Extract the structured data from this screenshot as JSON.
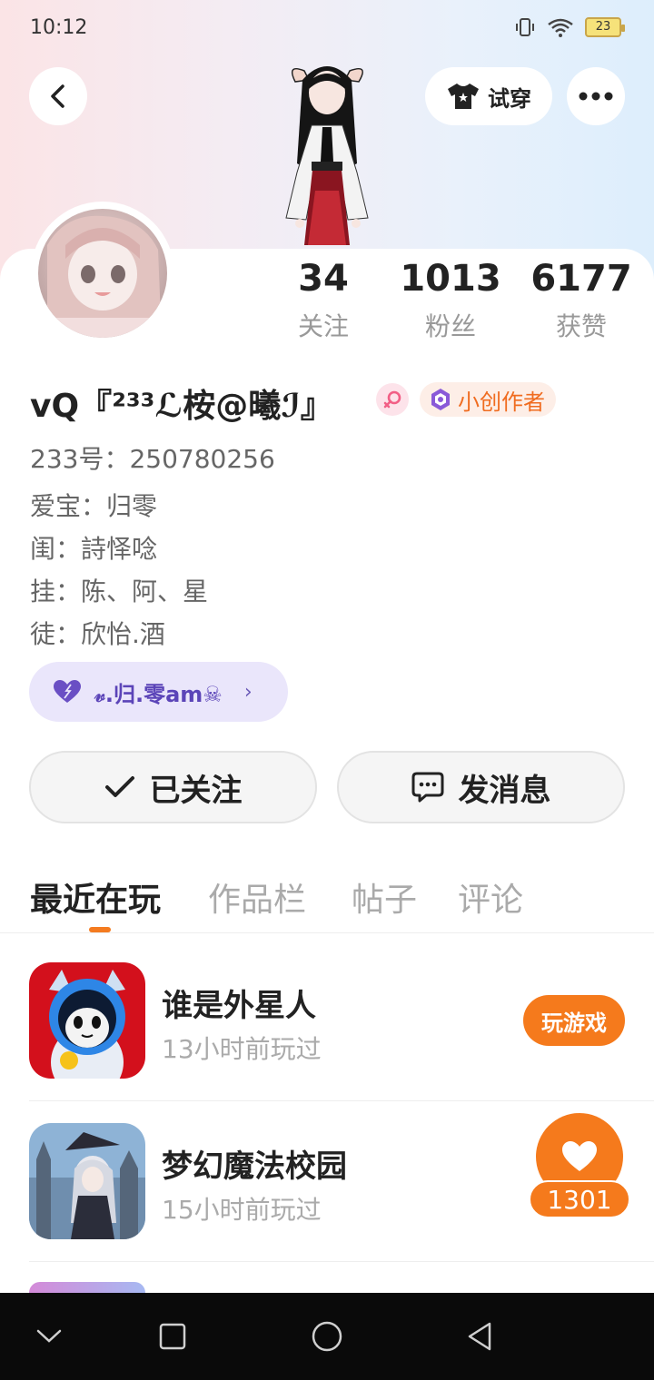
{
  "status_bar": {
    "time": "10:12",
    "battery": "23"
  },
  "header": {
    "try_on_label": "试穿"
  },
  "stats": [
    {
      "value": "34",
      "label": "关注"
    },
    {
      "value": "1013",
      "label": "粉丝"
    },
    {
      "value": "6177",
      "label": "获赞"
    }
  ],
  "profile": {
    "username": "vQ『²³³ℒ桉@曦ℐ』",
    "creator_badge": "小创作者",
    "uid": "233号：250780256",
    "bio_lines": [
      "爱宝：归零",
      "闺：詩怿唸",
      "挂：陈、阿、星",
      "徒：欣怡.酒"
    ],
    "tag": "𝓋.归.零am☠"
  },
  "actions": {
    "follow_label": "已关注",
    "message_label": "发消息"
  },
  "tabs": [
    "最近在玩",
    "作品栏",
    "帖子",
    "评论"
  ],
  "games": [
    {
      "title": "谁是外星人",
      "time": "13小时前玩过",
      "button": "玩游戏"
    },
    {
      "title": "梦幻魔法校园",
      "time": "15小时前玩过"
    }
  ],
  "like_float": {
    "count": "1301"
  },
  "colors": {
    "accent": "#f57a1c",
    "tag_bg": "#eae6fb",
    "tag_text": "#5b44b8"
  }
}
